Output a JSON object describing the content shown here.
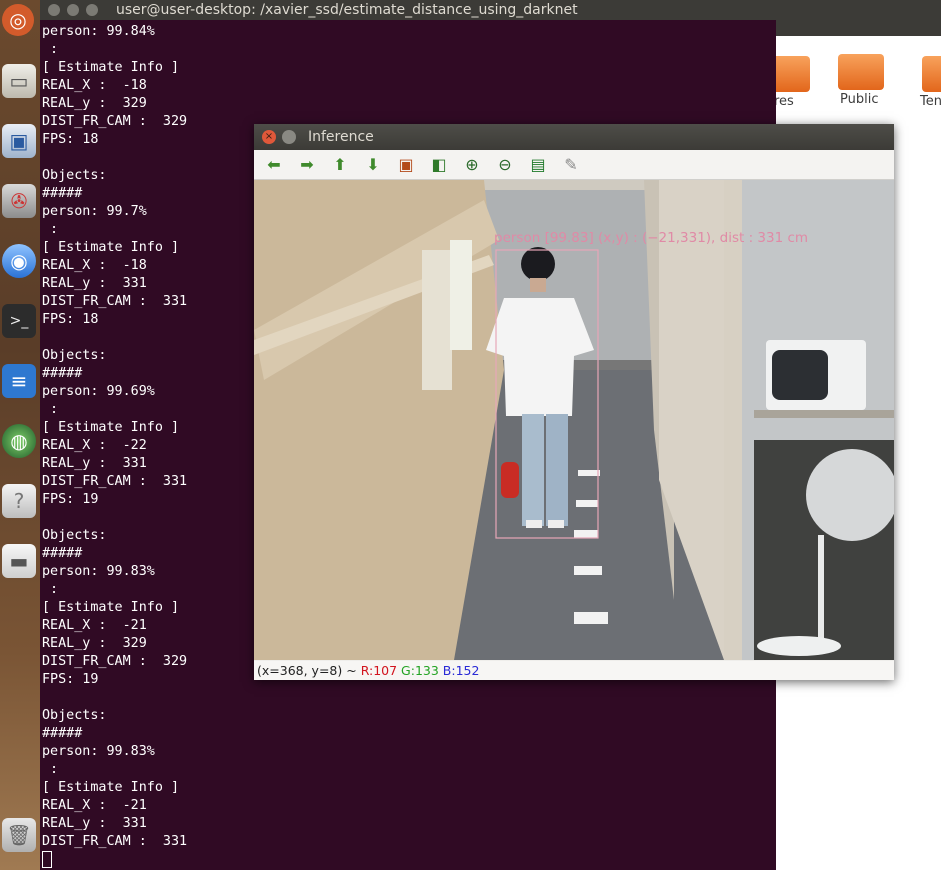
{
  "launcher": {
    "items": [
      "ubuntu-logo-icon",
      "files-icon",
      "software-center-icon",
      "settings-icon",
      "browser-icon",
      "terminal-icon",
      "text-editor-icon",
      "globe-icon",
      "help-icon",
      "drive-icon",
      "trash-icon"
    ]
  },
  "terminal": {
    "title": "user@user-desktop: /xavier_ssd/estimate_distance_using_darknet",
    "lines": [
      "person: 99.84%",
      " :",
      "[ Estimate Info ]",
      "REAL_X :  -18",
      "REAL_y :  329",
      "DIST_FR_CAM :  329",
      "FPS: 18",
      "",
      "Objects:",
      "#####",
      "person: 99.7%",
      " :",
      "[ Estimate Info ]",
      "REAL_X :  -18",
      "REAL_y :  331",
      "DIST_FR_CAM :  331",
      "FPS: 18",
      "",
      "Objects:",
      "#####",
      "person: 99.69%",
      " :",
      "[ Estimate Info ]",
      "REAL_X :  -22",
      "REAL_y :  331",
      "DIST_FR_CAM :  331",
      "FPS: 19",
      "",
      "Objects:",
      "#####",
      "person: 99.83%",
      " :",
      "[ Estimate Info ]",
      "REAL_X :  -21",
      "REAL_y :  329",
      "DIST_FR_CAM :  329",
      "FPS: 19",
      "",
      "Objects:",
      "#####",
      "person: 99.83%",
      " :",
      "[ Estimate Info ]",
      "REAL_X :  -21",
      "REAL_y :  331",
      "DIST_FR_CAM :  331"
    ]
  },
  "files": {
    "folders": [
      {
        "label": "res"
      },
      {
        "label": "Public"
      },
      {
        "label": "Ten"
      }
    ]
  },
  "inference": {
    "title": "Inference",
    "toolbar": [
      "arrow-left-icon",
      "arrow-right-icon",
      "arrow-up-icon",
      "arrow-down-icon",
      "image-icon",
      "image-zoom-icon",
      "zoom-in-icon",
      "zoom-out-icon",
      "save-icon",
      "brush-icon"
    ],
    "detection_label": "person [99.83] (x,y) : (−21,331), dist : 331 cm",
    "status": {
      "coords": "(x=368, y=8) ~",
      "r": "R:107",
      "g": "G:133",
      "b": "B:152"
    }
  }
}
